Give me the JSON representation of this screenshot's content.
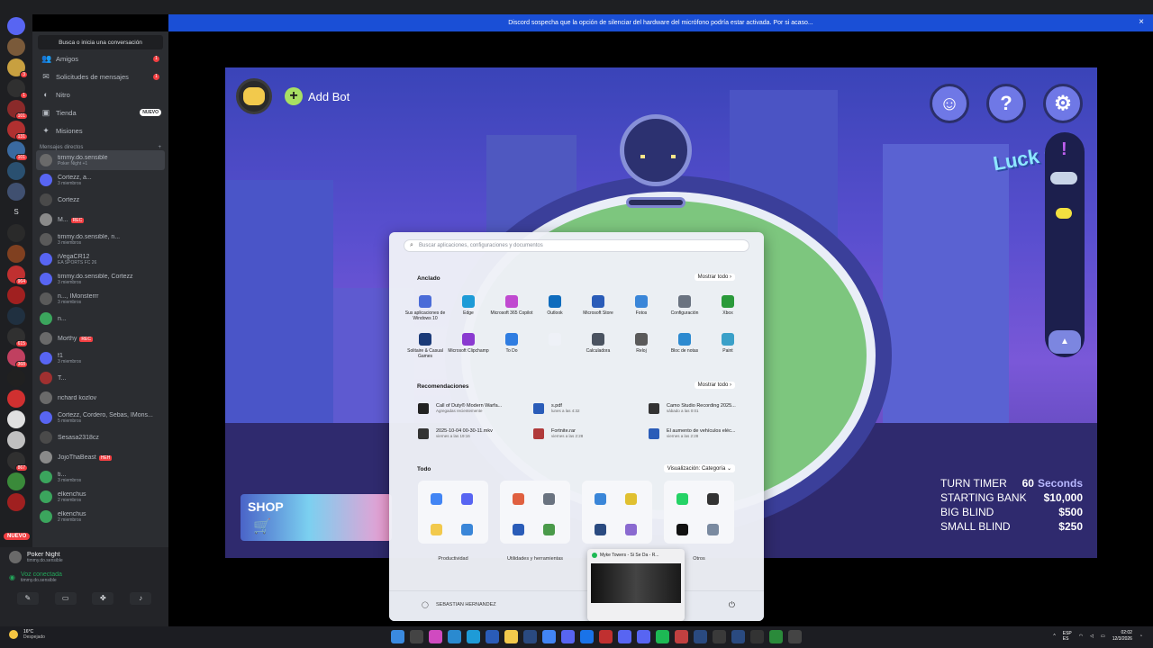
{
  "notice": {
    "text": "Discord sospecha que la opción de silenciar del hardware del micrófono podría estar activada. Por si acaso...",
    "close": "×"
  },
  "guilds": {
    "items": [
      {
        "color": "#5865f2",
        "badge": ""
      },
      {
        "color": "#7a5a3a",
        "badge": ""
      },
      {
        "color": "#c8a040",
        "badge": "3"
      },
      {
        "color": "#303030",
        "badge": "1"
      },
      {
        "color": "#8a2a2a",
        "badge": "101"
      },
      {
        "color": "#b03030",
        "badge": "131"
      },
      {
        "color": "#3a6aa0",
        "badge": "101"
      },
      {
        "color": "#2a5070",
        "badge": ""
      },
      {
        "color": "#405070",
        "badge": ""
      },
      {
        "color": "#2a2a2a",
        "badge": ""
      },
      {
        "color": "#804020",
        "badge": ""
      },
      {
        "color": "#c03030",
        "badge": "964"
      },
      {
        "color": "#a02020",
        "badge": ""
      },
      {
        "color": "#203040",
        "badge": ""
      },
      {
        "color": "#303030",
        "badge": "615"
      },
      {
        "color": "#c04060",
        "badge": "368"
      },
      {
        "color": "#202020",
        "badge": ""
      },
      {
        "color": "#d03030",
        "badge": ""
      },
      {
        "color": "#e0e0e0",
        "badge": ""
      },
      {
        "color": "#c0c0c0",
        "badge": ""
      },
      {
        "color": "#303030",
        "badge": "867"
      },
      {
        "color": "#3a8a3a",
        "badge": ""
      },
      {
        "color": "#a02020",
        "badge": ""
      }
    ],
    "s_label": "S",
    "nuevo": "NUEVO"
  },
  "dm": {
    "search": "Busca o inicia una conversación",
    "nav": [
      {
        "label": "Amigos",
        "icon": "👥",
        "badge": "1"
      },
      {
        "label": "Solicitudes de mensajes",
        "icon": "✉",
        "badge": "1"
      },
      {
        "label": "Nitro",
        "icon": "◐",
        "badge": ""
      },
      {
        "label": "Tienda",
        "icon": "▣",
        "badge": ""
      },
      {
        "label": "Misiones",
        "icon": "✦",
        "badge": ""
      }
    ],
    "tienda_new": "NUEVO",
    "header": "Mensajes directos",
    "header_add": "+",
    "rows": [
      {
        "name": "timmy.do.sensible",
        "sub": "Poker Night +1",
        "color": "#6a6a6a",
        "rec": ""
      },
      {
        "name": "Cortezz, a...",
        "sub": "3 miembros",
        "color": "#5865f2",
        "rec": ""
      },
      {
        "name": "Cortezz",
        "sub": "",
        "color": "#4a4a4a",
        "rec": ""
      },
      {
        "name": "M...",
        "sub": "",
        "color": "#8a8a8a",
        "rec": "REC"
      },
      {
        "name": "timmy.do.sensible, n...",
        "sub": "3 miembros",
        "color": "#5a5a5a",
        "rec": ""
      },
      {
        "name": "iVegaCR12",
        "sub": "EA SPORTS FC 26",
        "color": "#5865f2",
        "rec": ""
      },
      {
        "name": "timmy.do.sensible, Cortezz",
        "sub": "3 miembros",
        "color": "#5865f2",
        "rec": ""
      },
      {
        "name": "n..., IMonsterrr",
        "sub": "3 miembros",
        "color": "#5a5a5a",
        "rec": ""
      },
      {
        "name": "n...",
        "sub": "",
        "color": "#3ba55d",
        "rec": ""
      },
      {
        "name": "Morthy",
        "sub": "",
        "color": "#6a6a6a",
        "rec": "REC"
      },
      {
        "name": "f1",
        "sub": "3 miembros",
        "color": "#5865f2",
        "rec": ""
      },
      {
        "name": "T...",
        "sub": "",
        "color": "#a03030",
        "rec": ""
      },
      {
        "name": "richard kozlov",
        "sub": "",
        "color": "#6a6a6a",
        "rec": ""
      },
      {
        "name": "Cortezz, Cordero, Sebas, IMons...",
        "sub": "5 miembros",
        "color": "#5865f2",
        "rec": ""
      },
      {
        "name": "Sesasa2318cz",
        "sub": "",
        "color": "#4a4a4a",
        "rec": ""
      },
      {
        "name": "JojoThaBeast",
        "sub": "",
        "color": "#8a8a8a",
        "rec": "HEH"
      },
      {
        "name": "ti...",
        "sub": "3 miembros",
        "color": "#3ba55d",
        "rec": ""
      },
      {
        "name": "elkenchus",
        "sub": "2 miembros",
        "color": "#3ba55d",
        "rec": ""
      },
      {
        "name": "elkenchus",
        "sub": "2 miembros",
        "color": "#3ba55d",
        "rec": ""
      }
    ]
  },
  "userpanel": {
    "activity_title": "Poker Night",
    "activity_sub": "timmy.do.sensible",
    "voice": "Voz conectada",
    "voice_sub": "timmy.do.sensible"
  },
  "game": {
    "add_bot": "Add Bot",
    "buttons": [
      {
        "symbol": "☺",
        "icon": "smiley-icon"
      },
      {
        "symbol": "?",
        "icon": "help-icon"
      },
      {
        "symbol": "⚙",
        "icon": "gear-icon"
      }
    ],
    "lucky": "Luck City",
    "shop": "SHOP",
    "timer": {
      "turn_timer_label": "TURN TIMER",
      "turn_timer_value": "60",
      "turn_timer_unit": "Seconds",
      "starting_bank_label": "STARTING BANK",
      "starting_bank_value": "$10,000",
      "big_blind_label": "BIG BLIND",
      "big_blind_value": "$500",
      "small_blind_label": "SMALL BLIND",
      "small_blind_value": "$250"
    }
  },
  "startmenu": {
    "search_placeholder": "Buscar aplicaciones, configuraciones y documentos",
    "pinned_title": "Anclado",
    "show_all": "Mostrar todo  ›",
    "pinned": [
      {
        "label": "Sus aplicaciones de Windows 10",
        "color": "#4b6cd8"
      },
      {
        "label": "Edge",
        "color": "#1e9bd7"
      },
      {
        "label": "Microsoft 365 Copilot",
        "color": "#c04ad0"
      },
      {
        "label": "Outlook",
        "color": "#0f6cbd"
      },
      {
        "label": "Microsoft Store",
        "color": "#2a5cb8"
      },
      {
        "label": "Fotos",
        "color": "#3a86d8"
      },
      {
        "label": "Configuración",
        "color": "#6a7380"
      },
      {
        "label": "Xbox",
        "color": "#2a9a3a"
      },
      {
        "label": "Solitaire & Casual Games",
        "color": "#1b3a78"
      },
      {
        "label": "Microsoft Clipchamp",
        "color": "#8a3ad0"
      },
      {
        "label": "To Do",
        "color": "#2f7de1"
      },
      {
        "label": "",
        "color": "#eef1f7"
      },
      {
        "label": "Calculadora",
        "color": "#4a5360"
      },
      {
        "label": "Reloj",
        "color": "#5a5a5a"
      },
      {
        "label": "Bloc de notas",
        "color": "#2c8ad0"
      },
      {
        "label": "Paint",
        "color": "#3aa0c8"
      }
    ],
    "rec_title": "Recomendaciones",
    "rec_more": "Mostrar todo  ›",
    "recs": [
      {
        "title": "Call of Duty® Modern Warfa...",
        "sub": "Agregadas recientemente",
        "color": "#222"
      },
      {
        "title": "s.pdf",
        "sub": "lunes a las 4:32",
        "color": "#2a5cb8"
      },
      {
        "title": "Camo Studio Recording 2025...",
        "sub": "sábado a las 0:01",
        "color": "#333"
      },
      {
        "title": "2025-10-04 00-30-11.mkv",
        "sub": "viernes a las 19:16",
        "color": "#333"
      },
      {
        "title": "Fortnite.rar",
        "sub": "viernes a las 2:28",
        "color": "#b03a3a"
      },
      {
        "title": "El aumento de vehículos eléc...",
        "sub": "viernes a las 2:28",
        "color": "#2a5cb8"
      }
    ],
    "all_title": "Todo",
    "view": "Visualización: Categoría  ⌄",
    "categories": [
      {
        "label": "Productividad",
        "icons": [
          "#4285f4",
          "#5865f2",
          "#f2c94c",
          "#3a86d8"
        ]
      },
      {
        "label": "Utilidades y herramientas",
        "icons": [
          "#e06040",
          "#6a7380",
          "#2a5cb8",
          "#4a9a4a"
        ]
      },
      {
        "label": "",
        "icons": [
          "#3a86d8",
          "#e0c030",
          "#2a4a80",
          "#8a6ad0"
        ]
      },
      {
        "label": "Otros",
        "icons": [
          "#25d366",
          "#333",
          "#111",
          "#7a8aa0"
        ]
      }
    ],
    "user": "SEBASTIAN HERNANDEZ",
    "power": "⏻"
  },
  "preview": {
    "title": "Myke Towers - Si Se Da - R..."
  },
  "taskbar": {
    "temp": "16°C",
    "weather": "Despejado",
    "icons": [
      "#3a8ae0",
      "#444",
      "#d04ac0",
      "#2a8ad0",
      "#1e9bd7",
      "#2a5cb8",
      "#f2c94c",
      "#2a4a80",
      "#4285f4",
      "#5865f2",
      "#1a73e8",
      "#c03030",
      "#5865f2",
      "#5865f2",
      "#1db954",
      "#c04040",
      "#2a4a80",
      "#3a3a3a",
      "#2a4a80",
      "#333",
      "#2a8a3a",
      "#444"
    ],
    "lang": "ESP",
    "lang2": "ES",
    "time": "02:02",
    "date": "12/3/2026"
  }
}
